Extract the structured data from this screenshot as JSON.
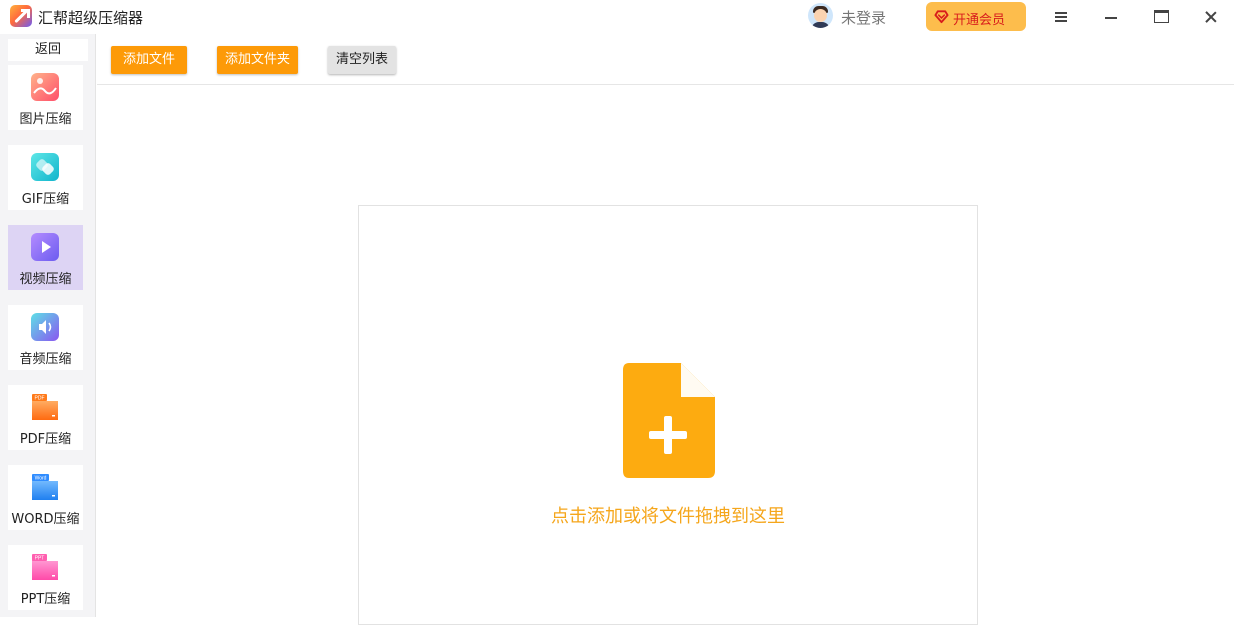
{
  "app": {
    "title": "汇帮超级压缩器"
  },
  "header": {
    "login_text": "未登录",
    "vip_label": "开通会员"
  },
  "sidebar": {
    "back_label": "返回",
    "items": [
      {
        "label": "图片压缩",
        "icon": "image-compress-icon",
        "color": "#ff6b6b",
        "active": false
      },
      {
        "label": "GIF压缩",
        "icon": "gif-compress-icon",
        "color": "#26c6da",
        "active": false
      },
      {
        "label": "视频压缩",
        "icon": "video-compress-icon",
        "color": "#8b6cf5",
        "active": true
      },
      {
        "label": "音频压缩",
        "icon": "audio-compress-icon",
        "color": "#7b68ee",
        "active": false
      },
      {
        "label": "PDF压缩",
        "icon": "pdf-compress-icon",
        "color": "#ff7a1a",
        "active": false
      },
      {
        "label": "WORD压缩",
        "icon": "word-compress-icon",
        "color": "#2f8cff",
        "active": false
      },
      {
        "label": "PPT压缩",
        "icon": "ppt-compress-icon",
        "color": "#ff5fb0",
        "active": false
      }
    ],
    "icon_tags": {
      "pdf": "PDF",
      "word": "Word",
      "ppt": "PPT"
    }
  },
  "toolbar": {
    "add_file_label": "添加文件",
    "add_folder_label": "添加文件夹",
    "clear_list_label": "清空列表"
  },
  "main": {
    "drop_text": "点击添加或将文件拖拽到这里"
  },
  "colors": {
    "accent": "#fd9a08",
    "drop_text": "#f5a61b",
    "vip": "#fdbd4c",
    "active_nav": "#ddd4f4"
  }
}
